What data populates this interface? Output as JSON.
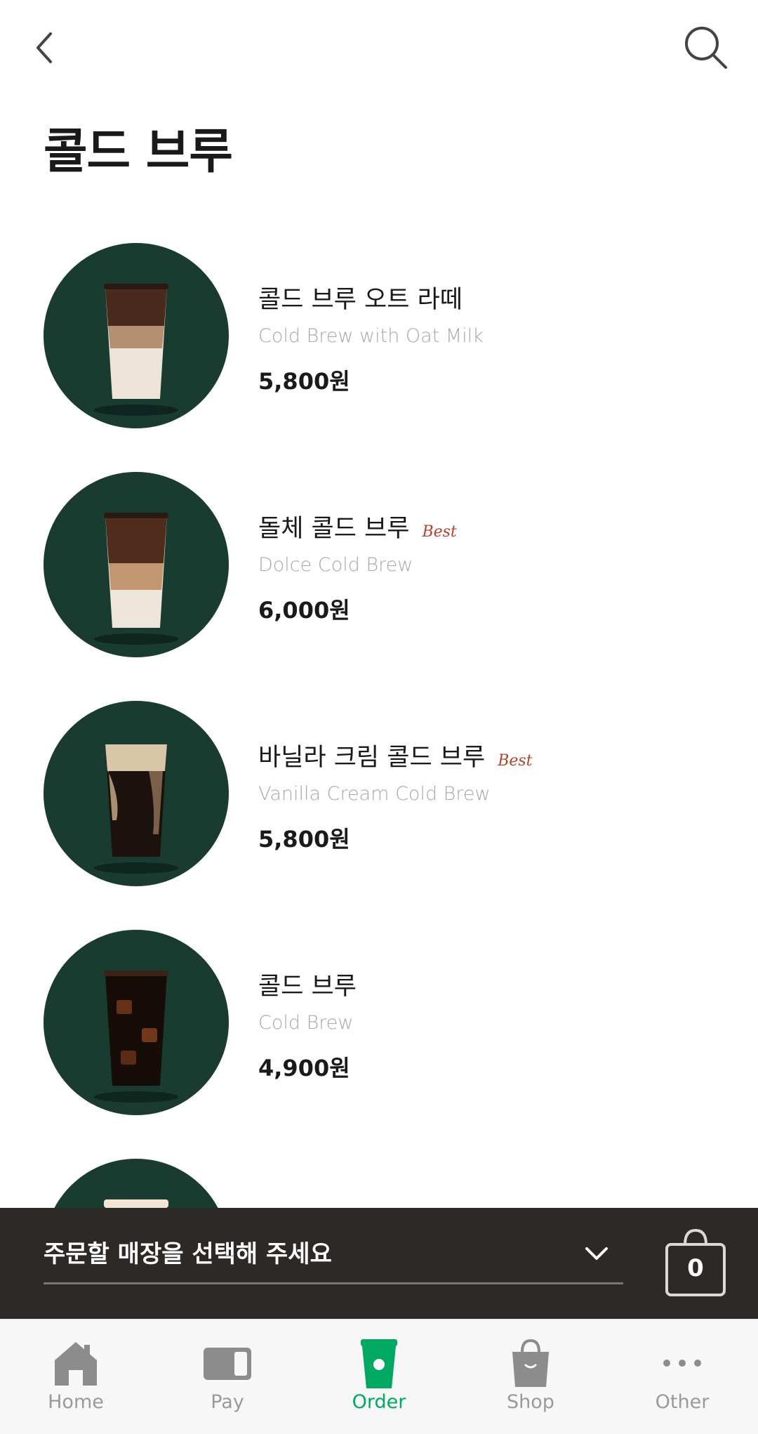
{
  "header": {
    "back_icon": "chevron-left-icon",
    "search_icon": "search-icon",
    "title": "콜드 브루"
  },
  "products": [
    {
      "name_ko": "콜드 브루 오트 라떼",
      "name_en": "Cold Brew with Oat Milk",
      "price": "5,800원",
      "badge": ""
    },
    {
      "name_ko": "돌체 콜드 브루",
      "name_en": "Dolce Cold Brew",
      "price": "6,000원",
      "badge": "Best"
    },
    {
      "name_ko": "바닐라 크림 콜드 브루",
      "name_en": "Vanilla Cream Cold Brew",
      "price": "5,800원",
      "badge": "Best"
    },
    {
      "name_ko": "콜드 브루",
      "name_en": "Cold Brew",
      "price": "4,900원",
      "badge": ""
    }
  ],
  "store_bar": {
    "placeholder": "주문할 매장을 선택해 주세요",
    "cart_count": "0"
  },
  "tabbar": {
    "tabs": [
      {
        "label": "Home",
        "icon": "home-icon",
        "active": false
      },
      {
        "label": "Pay",
        "icon": "card-icon",
        "active": false
      },
      {
        "label": "Order",
        "icon": "cup-icon",
        "active": true
      },
      {
        "label": "Shop",
        "icon": "shopping-bag-icon",
        "active": false
      },
      {
        "label": "Other",
        "icon": "more-icon",
        "active": false
      }
    ]
  },
  "colors": {
    "brand_green": "#00a862",
    "thumb_bg": "#1a3b30",
    "store_bar_bg": "#2d2926",
    "best_badge": "#b7412f"
  }
}
